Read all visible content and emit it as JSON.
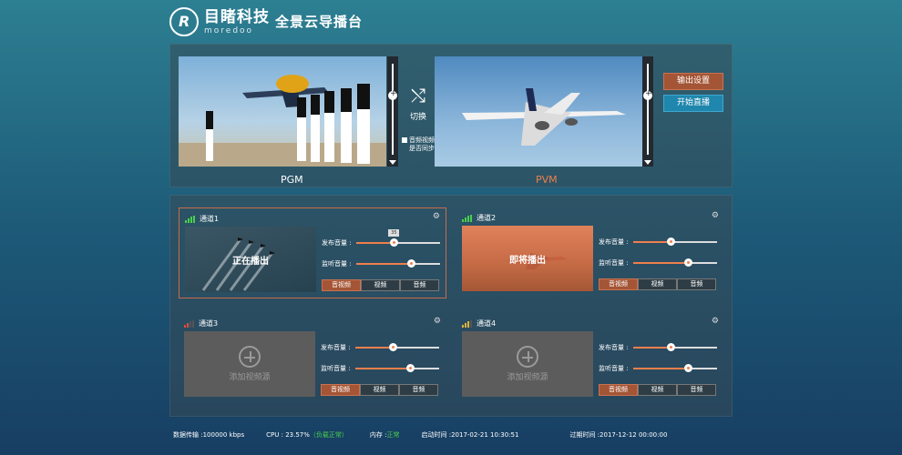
{
  "header": {
    "logo_cn": "目睹科技",
    "logo_en": "moredoo",
    "title": "全景云导播台"
  },
  "top": {
    "pgm_label": "PGM",
    "pvm_label": "PVM",
    "switch_label": "切换",
    "sync_line1": "音频视频",
    "sync_line2": "是否同步",
    "output_settings": "输出设置",
    "start_live": "开始直播"
  },
  "channels": [
    {
      "name": "通道1",
      "overlay": "正在播出",
      "publish_label": "发布音量 :",
      "monitor_label": "监听音量 :",
      "publish_tip": "35",
      "tabs": [
        "音视频",
        "视频",
        "音频"
      ]
    },
    {
      "name": "通道2",
      "overlay": "即将播出",
      "publish_label": "发布音量 :",
      "monitor_label": "监听音量 :",
      "tabs": [
        "音视频",
        "视频",
        "音频"
      ]
    },
    {
      "name": "通道3",
      "add_label": "添加视频源",
      "publish_label": "发布音量 :",
      "monitor_label": "监听音量 :",
      "tabs": [
        "音视频",
        "视频",
        "音频"
      ]
    },
    {
      "name": "通道4",
      "add_label": "添加视频源",
      "publish_label": "发布音量 :",
      "monitor_label": "监听音量 :",
      "tabs": [
        "音视频",
        "视频",
        "音频"
      ]
    }
  ],
  "volumes": {
    "publish": [
      0.45,
      0.45,
      0.45,
      0.45
    ],
    "monitor": [
      0.65,
      0.65,
      0.65,
      0.65
    ]
  },
  "status": {
    "transfer_label": "数据传输 :",
    "transfer_value": "100000 kbps",
    "cpu_label": "CPU :",
    "cpu_value": "23.57%",
    "cpu_note": "（负载正常）",
    "mem_label": "内存 :",
    "mem_value": "正常",
    "start_label": "启动时间 :",
    "start_value": "2017-02-21  10:30:51",
    "expire_label": "过期时间 :",
    "expire_value": "2017-12-12 00:00:00"
  },
  "colors": {
    "accent": "#ef7f4c",
    "live": "#1f86ad",
    "ok": "#49d04c"
  }
}
